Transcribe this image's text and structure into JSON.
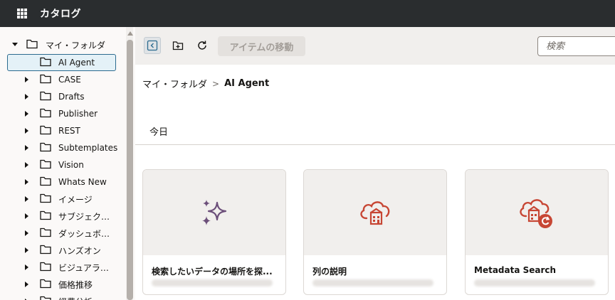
{
  "header": {
    "title": "カタログ",
    "grid_icon": "app-grid-icon"
  },
  "sidebar": {
    "root": {
      "label": "マイ・フォルダ"
    },
    "items": [
      {
        "label": "AI Agent",
        "selected": true,
        "expandable": false
      },
      {
        "label": "CASE",
        "expandable": true
      },
      {
        "label": "Drafts",
        "expandable": true
      },
      {
        "label": "Publisher",
        "expandable": true
      },
      {
        "label": "REST",
        "expandable": true
      },
      {
        "label": "Subtemplates",
        "expandable": true
      },
      {
        "label": "Vision",
        "expandable": true
      },
      {
        "label": "Whats New",
        "expandable": true
      },
      {
        "label": "イメージ",
        "expandable": true
      },
      {
        "label": "サブジェク…",
        "expandable": true
      },
      {
        "label": "ダッシュボ…",
        "expandable": true
      },
      {
        "label": "ハンズオン",
        "expandable": true
      },
      {
        "label": "ビジュアラ…",
        "expandable": true
      },
      {
        "label": "価格推移",
        "expandable": true
      },
      {
        "label": "経費分析",
        "expandable": true
      }
    ]
  },
  "toolbar": {
    "collapse_icon": "collapse-panel-icon",
    "new_folder_icon": "new-folder-icon",
    "refresh_icon": "refresh-icon",
    "move_label": "アイテムの移動",
    "search_placeholder": "検索"
  },
  "breadcrumb": {
    "parent": "マイ・フォルダ",
    "separator": ">",
    "current": "AI Agent"
  },
  "section": {
    "label": "今日"
  },
  "cards": [
    {
      "title": "検索したいデータの場所を探...",
      "icon": "sparkle-icon",
      "icon_color": "#6c4f7a"
    },
    {
      "title": "列の説明",
      "icon": "cloud-dataset-icon",
      "icon_color": "#c74634"
    },
    {
      "title": "Metadata Search",
      "icon": "cloud-dataset-refresh-icon",
      "icon_color": "#c74634"
    }
  ],
  "colors": {
    "topbar": "#2a2d2f",
    "accent": "#c74634",
    "selected_border": "#2c6b8f"
  }
}
